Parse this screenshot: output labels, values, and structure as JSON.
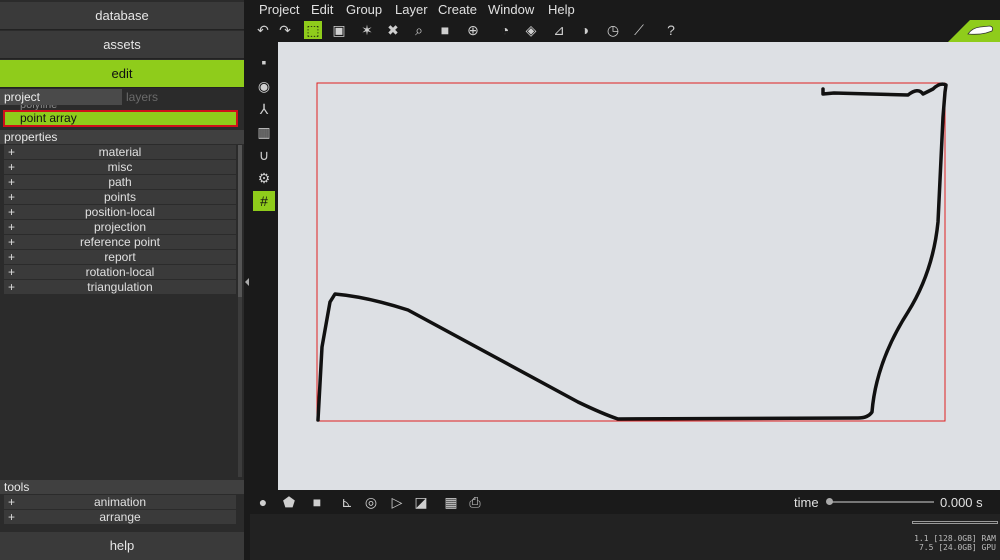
{
  "left_panel": {
    "database_label": "database",
    "assets_label": "assets",
    "edit_label": "edit",
    "tabs": {
      "project": "project",
      "layers": "layers"
    },
    "object_above": "polyline",
    "selected_object": "point array",
    "properties_header": "properties",
    "properties": [
      "material",
      "misc",
      "path",
      "points",
      "position-local",
      "projection",
      "reference point",
      "report",
      "rotation-local",
      "triangulation"
    ],
    "tools_header": "tools",
    "tools": [
      "animation",
      "arrange"
    ],
    "help_label": "help"
  },
  "menu": [
    "Project",
    "Edit",
    "Group",
    "Layer",
    "Create",
    "Window",
    "Help"
  ],
  "toolbar_icons": [
    "undo-icon",
    "redo-icon",
    "select-cursor-icon",
    "select-rectangle-icon",
    "transform-icon",
    "delete-icon",
    "zoom-icon",
    "cube-icon",
    "move-icon",
    "gauge-icon",
    "tag-icon",
    "measure-icon",
    "compass-icon",
    "dial-icon",
    "ruler-icon",
    "help-circle-icon"
  ],
  "timeline": {
    "time_label": "time",
    "time_value": "0.000 s",
    "time_position": 0.0
  },
  "status": {
    "ram": "1.1 [128.0GB] RAM",
    "gpu": "7.5 [24.0GB] GPU"
  },
  "colors": {
    "accent": "#8fcc1b",
    "selection_border": "#d0101a",
    "bounds_rect": "#e02020",
    "path_stroke": "#111111"
  }
}
